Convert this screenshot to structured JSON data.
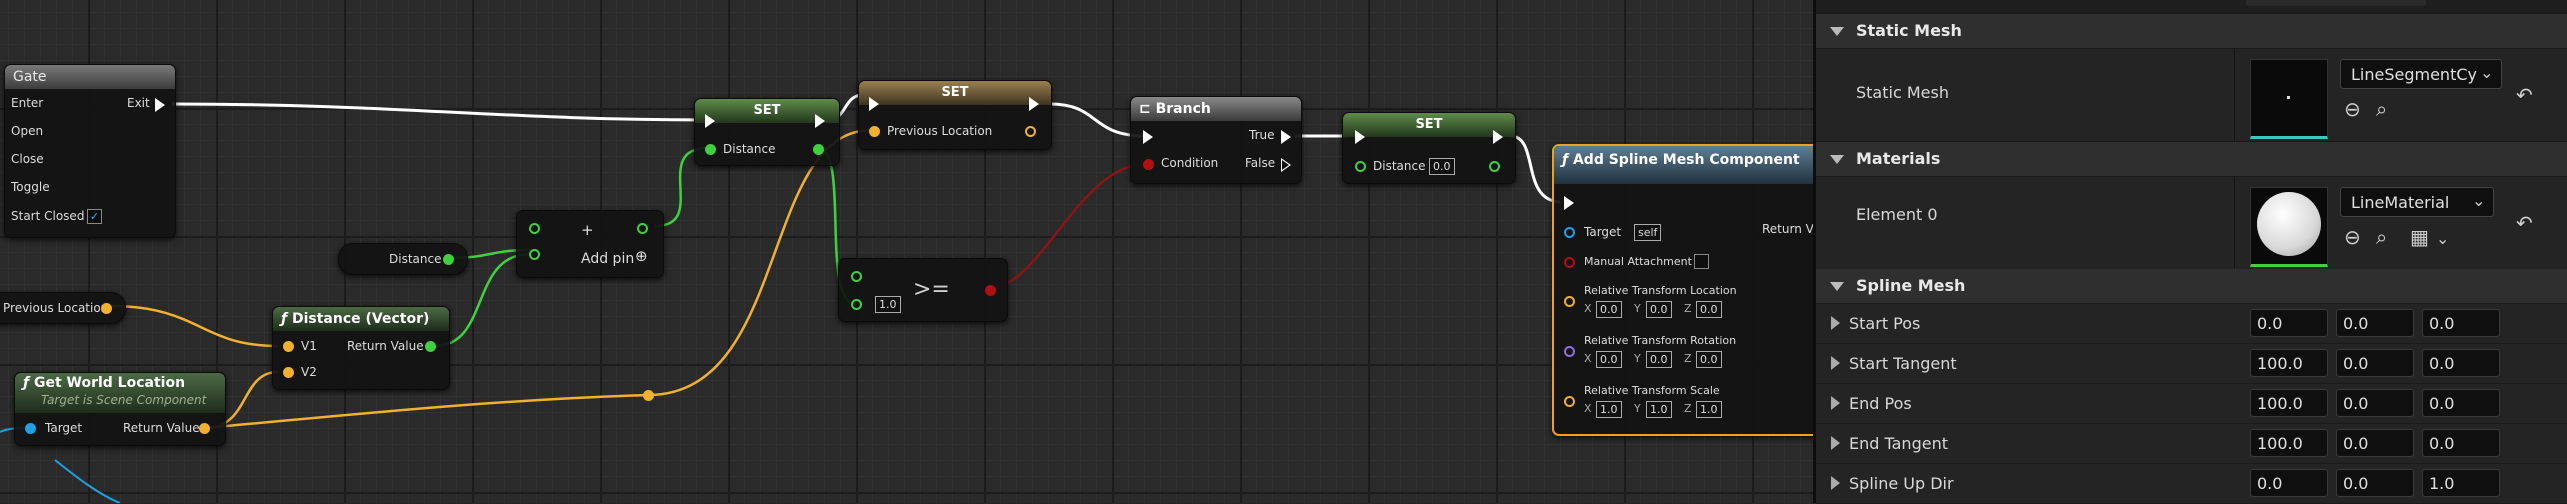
{
  "graph": {
    "gate": {
      "title": "Gate",
      "enter": "Enter",
      "exit": "Exit",
      "open": "Open",
      "close": "Close",
      "toggle": "Toggle",
      "start_closed": "Start Closed"
    },
    "set1": {
      "title": "SET",
      "distance": "Distance"
    },
    "set2": {
      "title": "SET",
      "previous_location": "Previous Location"
    },
    "branch": {
      "title": "Branch",
      "true_label": "True",
      "condition": "Condition",
      "false_label": "False"
    },
    "set3": {
      "title": "SET",
      "distance": "Distance",
      "value": "0.0"
    },
    "distance_getter": {
      "label": "Distance"
    },
    "add_node": {
      "add_pin": "Add pin"
    },
    "compare": {
      "op": ">=",
      "value": "1.0"
    },
    "prev_loc_getter": {
      "label": "Previous Location"
    },
    "distance_vector": {
      "title": "Distance (Vector)",
      "v1": "V1",
      "v2": "V2",
      "return_value": "Return Value"
    },
    "get_world_location": {
      "title": "Get World Location",
      "subtitle": "Target is Scene Component",
      "target": "Target",
      "return_value": "Return Value"
    },
    "add_spline": {
      "title": "Add Spline Mesh Component",
      "target": "Target",
      "target_value": "self",
      "return_value": "Return Va",
      "manual_attachment": "Manual Attachment",
      "rel_loc": "Relative Transform Location",
      "rel_rot": "Relative Transform Rotation",
      "rel_scale": "Relative Transform Scale",
      "x": "X",
      "y": "Y",
      "z": "Z",
      "loc": [
        "0.0",
        "0.0",
        "0.0"
      ],
      "rot": [
        "0.0",
        "0.0",
        "0.0"
      ],
      "scale": [
        "1.0",
        "1.0",
        "1.0"
      ]
    }
  },
  "details": {
    "static_mesh_section": "Static Mesh",
    "static_mesh_label": "Static Mesh",
    "static_mesh_value": "LineSegmentCy",
    "materials_section": "Materials",
    "element0_label": "Element 0",
    "material_value": "LineMaterial",
    "spline_section": "Spline Mesh",
    "rows": [
      {
        "label": "Start Pos",
        "values": [
          "0.0",
          "0.0",
          "0.0"
        ]
      },
      {
        "label": "Start Tangent",
        "values": [
          "100.0",
          "0.0",
          "0.0"
        ]
      },
      {
        "label": "End Pos",
        "values": [
          "100.0",
          "0.0",
          "0.0"
        ]
      },
      {
        "label": "End Tangent",
        "values": [
          "100.0",
          "0.0",
          "0.0"
        ]
      },
      {
        "label": "Spline Up Dir",
        "values": [
          "0.0",
          "0.0",
          "1.0"
        ]
      }
    ]
  },
  "colors": {
    "exec": "#ffffff",
    "float": "#3fd13f",
    "vector": "#f0b030",
    "bool": "#b01010",
    "object": "#20a0e0",
    "accent_select": "#f0a020"
  }
}
